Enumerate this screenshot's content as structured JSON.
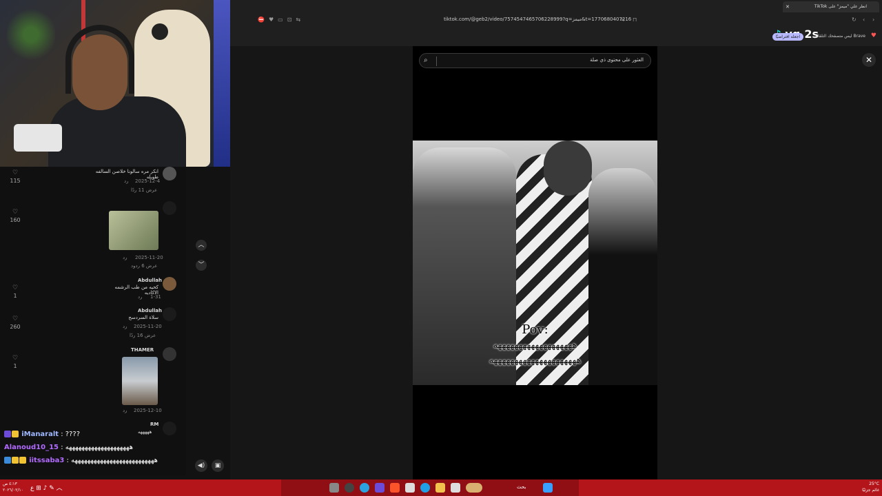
{
  "browser": {
    "tab_title": "انظر علي \"ميمز\" على TikTok",
    "new_tab": "+",
    "url": "tiktok.com/@geb2/video/7574547465706228999?q=ميمز&t=1770680407216",
    "notification_text": "Brave ليس متصفحك التلقائي.",
    "notification_pill": "اجعله افتراضيًا",
    "tiktok_logo": "vq.2s"
  },
  "viewer": {
    "search_placeholder": "العثور على محتوى ذي صلة",
    "close": "✕",
    "overlay_line1": "Pov:",
    "overlay_line2": "هههههههههههههههههههه",
    "overlay_line3": "هههههههههههههههههههههه"
  },
  "comments": [
    {
      "text": "انكر مره سالونا خلاصن السالفه طويله",
      "date": "2025-12-4",
      "reply": "رد",
      "view": "عرض 11 ردًا",
      "likes": "115"
    },
    {
      "text": "",
      "date": "2025-11-20",
      "reply": "رد",
      "view": "عرض 6 ردود",
      "likes": "160"
    },
    {
      "name": "Abdullah",
      "text": "كحيه من طب الرشمه الاكاديه",
      "date": "1-31",
      "reply": "رد",
      "likes": "1"
    },
    {
      "name": "Abdullah",
      "text": "سلاة السردسح",
      "date": "2025-11-20",
      "reply": "رد",
      "view": "عرض 16 ردًا",
      "likes": "260"
    },
    {
      "name": "THAMER",
      "text": "",
      "date": "2025-12-10",
      "reply": "رد",
      "likes": "1"
    },
    {
      "name": "RM",
      "text": "هههههه",
      "likes": ""
    }
  ],
  "chat": [
    {
      "name": "iManaralt",
      "msg": " : ????",
      "color": "#9fb8ff"
    },
    {
      "name": "Alanoud10_15",
      "msg": " : ههههههههههههههههههههه",
      "color": "#b26bff"
    },
    {
      "name": "iitssaba3",
      "msg": " : ههههههههههههههههههههههههههه",
      "color": "#b26bff"
    }
  ],
  "taskbar": {
    "search_label": "بحث",
    "clock_time": "٤:١٣ ص",
    "clock_date": "٢٠٢٦/٠٢/١٠",
    "weather_temp": "25°C",
    "weather_desc": "غائم جزئيًا"
  }
}
